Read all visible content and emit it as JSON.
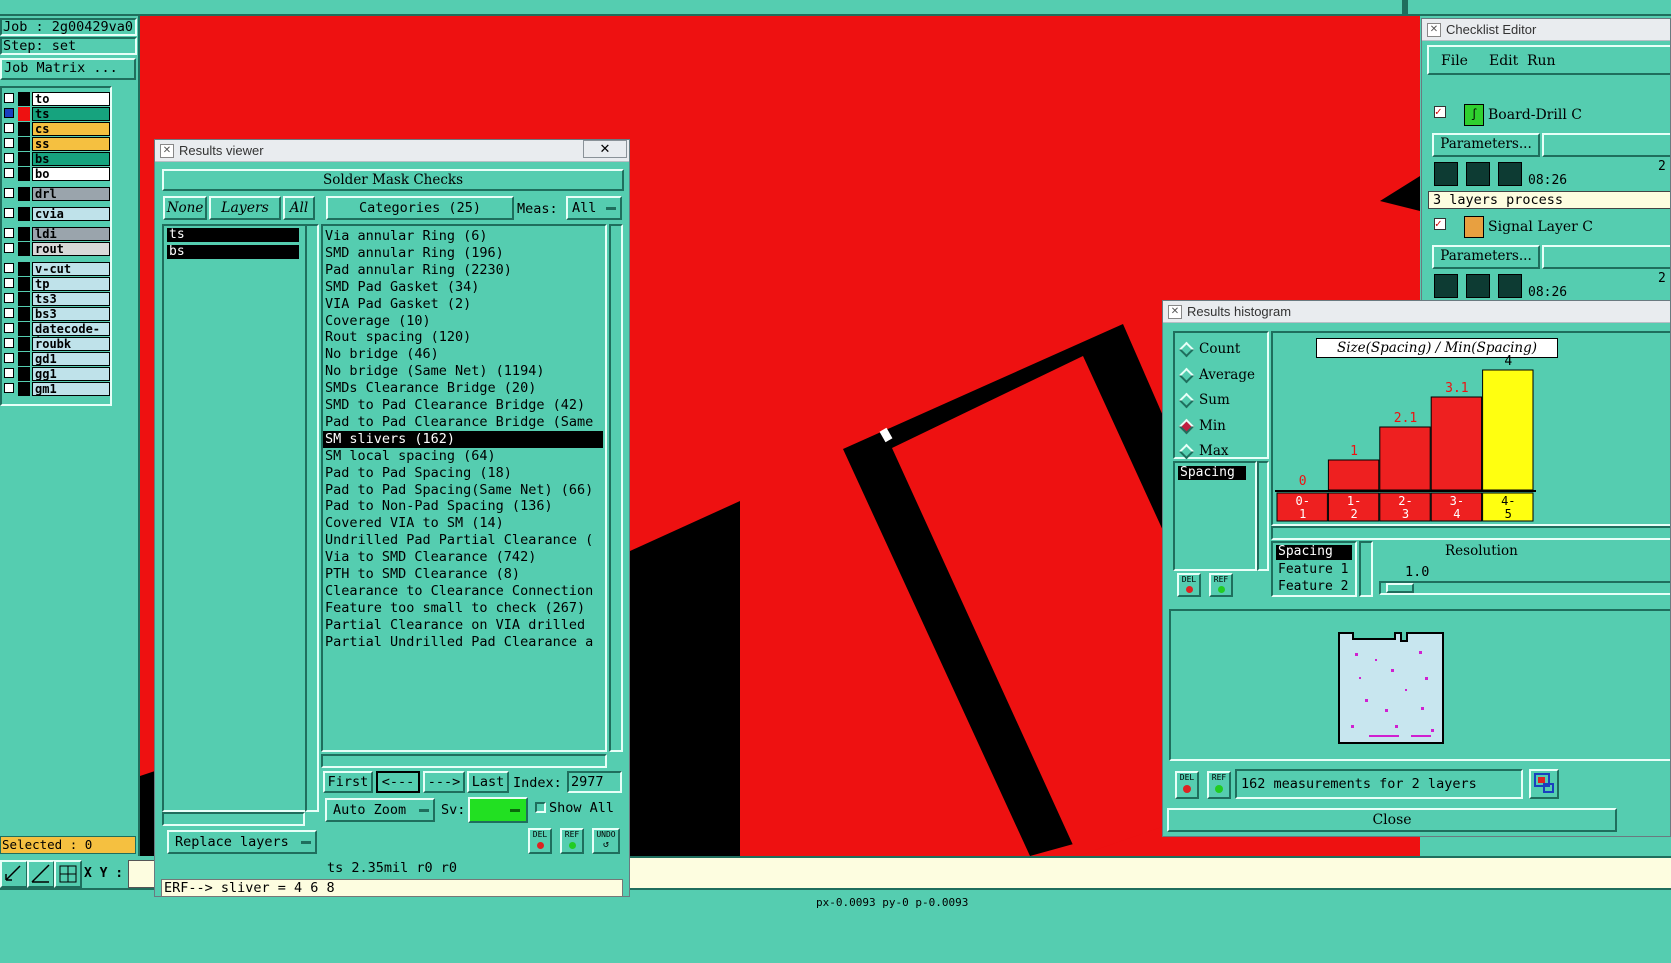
{
  "job": {
    "job_label": "Job : 2g00429va0",
    "step_label": "Step: set",
    "matrix_button": "Job Matrix ..."
  },
  "layers": [
    {
      "name": "to",
      "color": "#ffffff"
    },
    {
      "name": "ts",
      "color": "#16a37e"
    },
    {
      "name": "cs",
      "color": "#f5c040"
    },
    {
      "name": "ss",
      "color": "#f5c040"
    },
    {
      "name": "bs",
      "color": "#16a37e"
    },
    {
      "name": "bo",
      "color": "#ffffff"
    },
    {
      "name": "drl",
      "color": "#9aa4ac"
    },
    {
      "name": "cvia",
      "color": "#bfe2ea"
    },
    {
      "name": "ldi",
      "color": "#9aa4ac"
    },
    {
      "name": "rout",
      "color": "#d8d8d8"
    },
    {
      "name": "v-cut",
      "color": "#bfe2ea"
    },
    {
      "name": "tp",
      "color": "#bfe2ea"
    },
    {
      "name": "ts3",
      "color": "#bfe2ea"
    },
    {
      "name": "bs3",
      "color": "#bfe2ea"
    },
    {
      "name": "datecode-to",
      "color": "#bfe2ea"
    },
    {
      "name": "roubk",
      "color": "#bfe2ea"
    },
    {
      "name": "gd1",
      "color": "#bfe2ea"
    },
    {
      "name": "gg1",
      "color": "#bfe2ea"
    },
    {
      "name": "gm1",
      "color": "#bfe2ea"
    }
  ],
  "selected_label": "Selected : 0",
  "xy_label": "X Y :",
  "results_viewer": {
    "title": "Results viewer",
    "check_name": "Solder Mask Checks",
    "none_btn": "None",
    "layers_btn": "Layers",
    "all_btn": "All",
    "categories_btn": "Categories (25)",
    "meas_label": "Meas:",
    "meas_value": "All",
    "layer_list": [
      "ts",
      "bs"
    ],
    "categories": [
      "Via annular Ring (6)",
      "SMD annular Ring (196)",
      "Pad annular Ring (2230)",
      "SMD Pad Gasket (34)",
      "VIA Pad Gasket (2)",
      "Coverage (10)",
      "Rout spacing (120)",
      "No bridge (46)",
      "No bridge (Same Net) (1194)",
      "SMDs Clearance Bridge (20)",
      "SMD to Pad Clearance Bridge (42)",
      "Pad to Pad Clearance Bridge (Same",
      "SM slivers (162)",
      "SM local spacing (64)",
      "Pad to Pad Spacing (18)",
      "Pad to Pad Spacing(Same Net) (66)",
      "Pad to Non-Pad Spacing (136)",
      "Covered VIA to SM (14)",
      "Undrilled Pad Partial Clearance (",
      "Via to SMD Clearance (742)",
      "PTH to SMD Clearance (8)",
      "Clearance to Clearance Connection",
      "Feature too small to check (267)",
      "Partial Clearance on VIA drilled",
      "Partial Undrilled Pad Clearance a"
    ],
    "selected_category_index": 12,
    "first_btn": "First",
    "prev_btn": "<---",
    "next_btn": "--->",
    "last_btn": "Last",
    "index_label": "Index:",
    "index_value": "2977",
    "auto_zoom_btn": "Auto Zoom",
    "sv_label": "Sv:",
    "show_all_label": "Show All",
    "replace_layers_btn": "Replace layers",
    "del_label": "DEL",
    "ref_label": "REF",
    "undo_label": "UNDO",
    "status_line": "ts 2.35mil  r0  r0",
    "erf_line": "ERF--> sliver = 4 6 8"
  },
  "checklist_editor": {
    "title": "Checklist Editor",
    "menu": [
      "File",
      "Edit",
      "Run"
    ],
    "items": [
      {
        "name": "Board-Drill C",
        "params_btn": "Parameters...",
        "time_a": "2",
        "time_b": "08:26"
      },
      {
        "name": "Signal Layer C",
        "params_btn": "Parameters...",
        "time_a": "2",
        "time_b": "08:26"
      }
    ],
    "layers_processed": "3 layers process"
  },
  "histogram": {
    "title": "Results histogram",
    "modes": [
      "Count",
      "Average",
      "Sum",
      "Min",
      "Max"
    ],
    "selected_mode": "Min",
    "function_title": "Size(Spacing) / Min(Spacing)",
    "list_item": "Spacing",
    "measure_items": [
      "Spacing",
      "Feature 1",
      "Feature 2"
    ],
    "resolution_label": "Resolution",
    "resolution_value": "1.0",
    "summary": "162 measurements for 2 layers",
    "close_btn": "Close",
    "del_label": "DEL",
    "ref_label": "REF"
  },
  "chart_data": {
    "type": "bar",
    "title": "Size(Spacing) / Min(Spacing)",
    "categories": [
      "0-\n1",
      "1-\n2",
      "2-\n3",
      "3-\n4",
      "4-\n5"
    ],
    "values": [
      0,
      1,
      2.1,
      3.1,
      4
    ],
    "value_labels": [
      "0",
      "1",
      "2.1",
      "3.1",
      "4"
    ],
    "ylim": [
      0,
      4
    ],
    "colors": [
      "#ee2020",
      "#ee2020",
      "#ee2020",
      "#ee2020",
      "#ffff10"
    ]
  },
  "coord_status": "px-0.0093 py-0 p-0.0093",
  "colors": {
    "bg": "#55cdb0",
    "canvas": "#ee1111",
    "highlight": "#ffff10"
  }
}
